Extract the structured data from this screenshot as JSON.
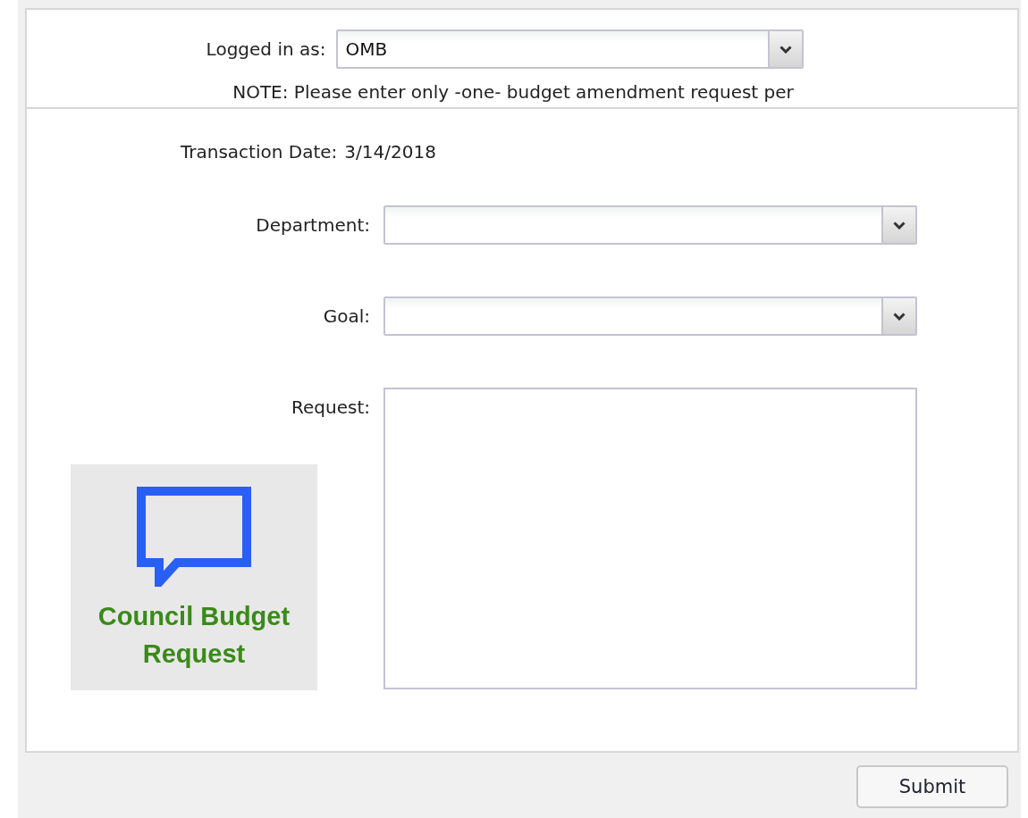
{
  "login": {
    "label": "Logged in as:",
    "value": "OMB"
  },
  "note": "NOTE: Please enter only -one- budget amendment request per",
  "transaction_date": {
    "label": "Transaction Date:",
    "value": "3/14/2018"
  },
  "fields": [
    {
      "label": "Department:",
      "kind": "select"
    },
    {
      "label": "Goal:",
      "kind": "select"
    },
    {
      "label": "Request:",
      "kind": "textarea"
    }
  ],
  "logo": {
    "title": "Council Budget Request"
  },
  "submit": "Submit"
}
